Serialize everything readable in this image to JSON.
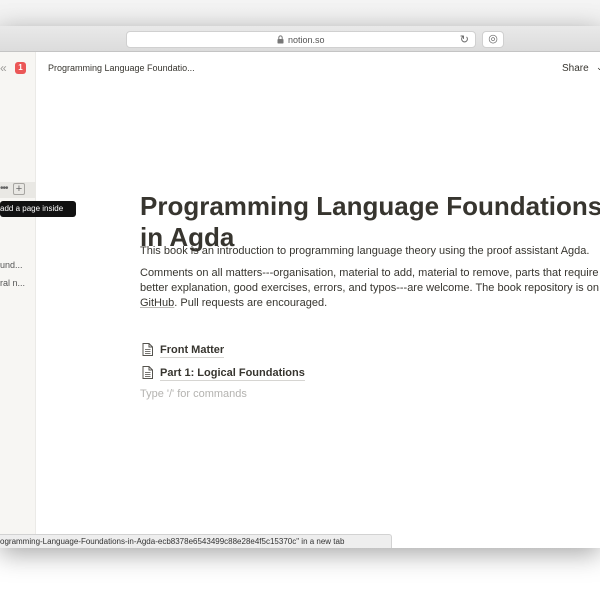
{
  "browser": {
    "url": "notion.so",
    "reload_glyph": "↻",
    "tools_glyph": "◎"
  },
  "sidebar": {
    "chevrons": "«",
    "badge_count": "1",
    "hover_dots": "•••",
    "add_glyph": "+",
    "items": [
      {
        "label": "und..."
      },
      {
        "label": "ral n..."
      }
    ]
  },
  "tooltip": {
    "text": "add a page inside"
  },
  "topbar": {
    "breadcrumb": "Programming Language Foundatio...",
    "share_label": "Share",
    "share_caret": "⌄"
  },
  "page": {
    "title_line1": "Programming Language Foundations",
    "title_line2": "in Agda",
    "para1": "This book is an introduction to programming language theory using the proof assistant Agda.",
    "para2_line1": "Comments on all matters---organisation, material to add, material to remove, parts that require",
    "para2_line2": "better explanation, good exercises, errors, and typos---are welcome. The book repository is on",
    "para2_link": "GitHub",
    "para2_tail": ". Pull requests are encouraged.",
    "subpages": [
      {
        "label": "Front Matter"
      },
      {
        "label": "Part 1: Logical Foundations"
      }
    ],
    "placeholder": "Type '/' for commands"
  },
  "statusbar": {
    "text": "ogramming-Language-Foundations-in-Agda-ecb8378e6543499c88e28e4f5c15370c\" in a new tab"
  },
  "colors": {
    "text": "#37352f",
    "sidebar_bg": "#f7f6f3",
    "badge": "#eb5757",
    "placeholder": "#b4b3b0"
  }
}
